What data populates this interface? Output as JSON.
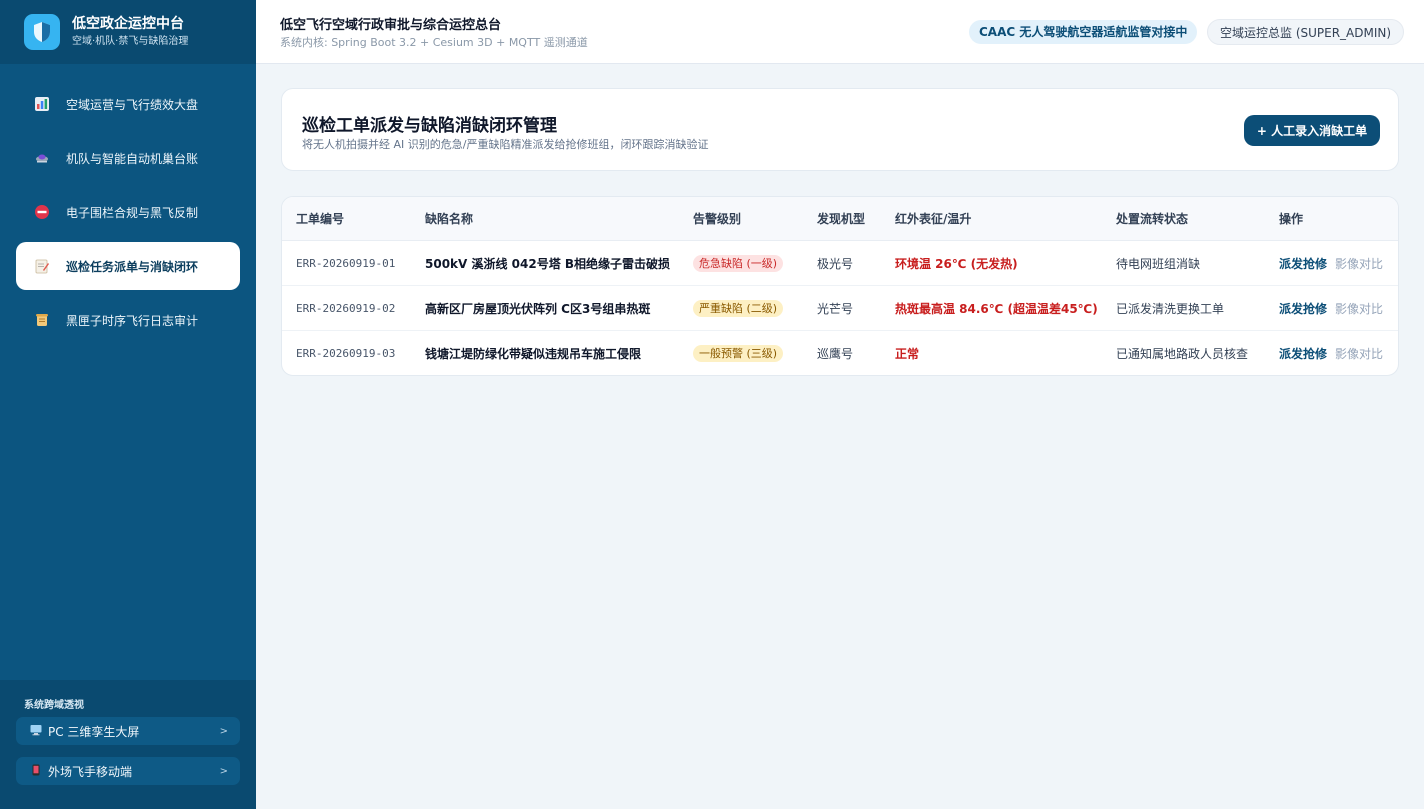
{
  "app": {
    "title": "低空政企运控中台",
    "subtitle": "空域·机队·禁飞与缺陷治理"
  },
  "nav": [
    {
      "label": "空域运营与飞行绩效大盘",
      "icon": "bar-chart-icon",
      "active": false
    },
    {
      "label": "机队与智能自动机巢台账",
      "icon": "drone-icon",
      "active": false
    },
    {
      "label": "电子围栏合规与黑飞反制",
      "icon": "no-entry-icon",
      "active": false
    },
    {
      "label": "巡检任务派单与消缺闭环",
      "icon": "memo-icon",
      "active": true
    },
    {
      "label": "黑匣子时序飞行日志审计",
      "icon": "scroll-icon",
      "active": false
    }
  ],
  "sidebar_bottom": {
    "title": "系统跨域透视",
    "links": [
      {
        "label": "PC 三维孪生大屏",
        "icon": "monitor-icon",
        "chevron": ">"
      },
      {
        "label": "外场飞手移动端",
        "icon": "mobile-icon",
        "chevron": ">"
      }
    ]
  },
  "topbar": {
    "title": "低空飞行空域行政审批与综合运控总台",
    "subtitle": "系统内核: Spring Boot 3.2 + Cesium 3D + MQTT 遥测通道",
    "caac_badge": "CAAC 无人驾驶航空器适航监管对接中",
    "user_role": "空域运控总监 (SUPER_ADMIN)"
  },
  "header_card": {
    "title": "巡检工单派发与缺陷消缺闭环管理",
    "subtitle": "将无人机拍摄并经 AI 识别的危急/严重缺陷精准派发给抢修班组，闭环跟踪消缺验证",
    "add_button": "+ 人工录入消缺工单"
  },
  "table": {
    "columns": [
      "工单编号",
      "缺陷名称",
      "告警级别",
      "发现机型",
      "红外表征/温升",
      "处置流转状态",
      "操作"
    ],
    "rows": [
      {
        "id": "ERR-20260919-01",
        "name": "500kV 溪浙线 042号塔 B相绝缘子雷击破损",
        "level": "危急缺陷 (一级)",
        "level_color": "#c92a2a",
        "model": "极光号",
        "thermal": "环境温 26℃ (无发热)",
        "status": "待电网班组消缺",
        "action_primary": "派发抢修",
        "action_secondary": "影像对比"
      },
      {
        "id": "ERR-20260919-02",
        "name": "高新区厂房屋顶光伏阵列 C区3号组串热斑",
        "level": "严重缺陷 (二级)",
        "level_color": "#8a5a00",
        "model": "光芒号",
        "thermal": "热斑最高温 84.6℃ (超温温差45℃)",
        "status": "已派发清洗更换工单",
        "action_primary": "派发抢修",
        "action_secondary": "影像对比"
      },
      {
        "id": "ERR-20260919-03",
        "name": "钱塘江堤防绿化带疑似违规吊车施工侵限",
        "level": "一般预警 (三级)",
        "level_color": "#8a5a00",
        "model": "巡鹰号",
        "thermal": "正常",
        "status": "已通知属地路政人员核查",
        "action_primary": "派发抢修",
        "action_secondary": "影像对比"
      }
    ]
  }
}
